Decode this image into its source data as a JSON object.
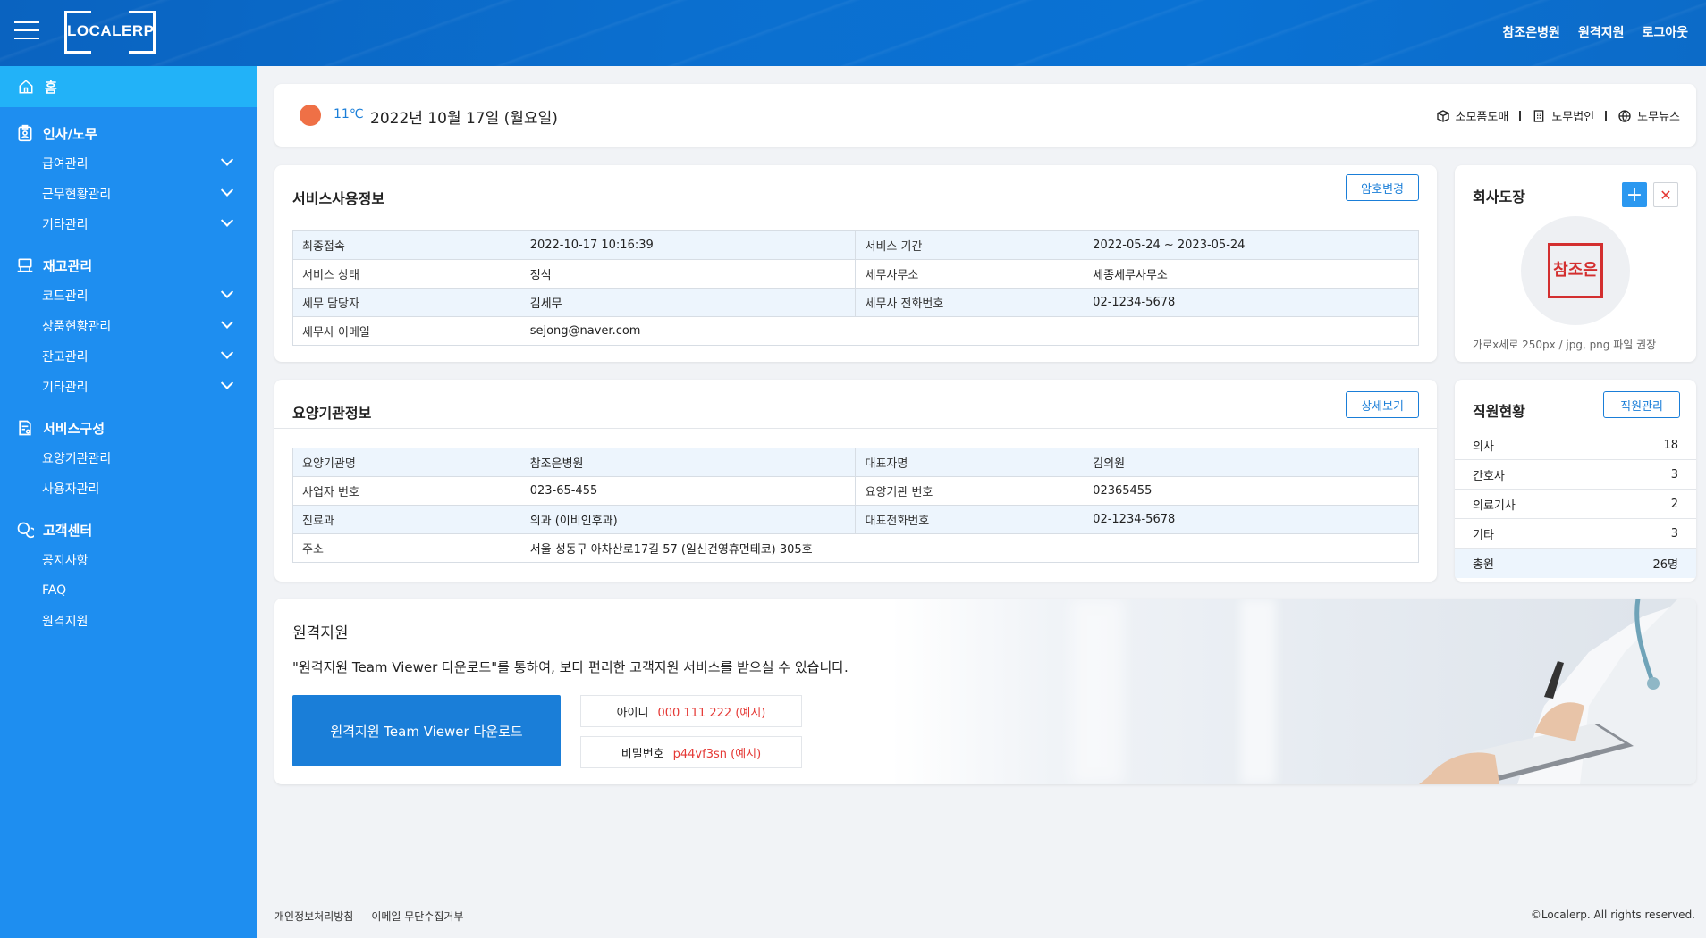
{
  "header": {
    "logo": "LOCALERP",
    "nav": [
      "참조은병원",
      "원격지원",
      "로그아웃"
    ]
  },
  "sidebar": {
    "home": "홈",
    "groups": [
      {
        "title": "인사/노무",
        "items": [
          "급여관리",
          "근무현황관리",
          "기타관리"
        ]
      },
      {
        "title": "재고관리",
        "items": [
          "코드관리",
          "상품현황관리",
          "잔고관리",
          "기타관리"
        ]
      },
      {
        "title": "서비스구성",
        "items": [
          "요양기관관리",
          "사용자관리"
        ]
      },
      {
        "title": "고객센터",
        "items": [
          "공지사항",
          "FAQ",
          "원격지원"
        ]
      }
    ]
  },
  "weather": {
    "temp": "11℃",
    "date": "2022년 10월 17일 (월요일)",
    "links": [
      "소모품도매",
      "노무법인",
      "노무뉴스"
    ]
  },
  "service_info": {
    "title": "서비스사용정보",
    "button": "암호변경",
    "rows": [
      [
        "최종접속",
        "2022-10-17 10:16:39",
        "서비스 기간",
        "2022-05-24 ~ 2023-05-24"
      ],
      [
        "서비스 상태",
        "정식",
        "세무사무소",
        "세종세무사무소"
      ],
      [
        "세무 담당자",
        "김세무",
        "세무사 전화번호",
        "02-1234-5678"
      ],
      [
        "세무사 이메일",
        "sejong@naver.com"
      ]
    ]
  },
  "facility_info": {
    "title": "요양기관정보",
    "button": "상세보기",
    "rows": [
      [
        "요양기관명",
        "참조은병원",
        "대표자명",
        "김의원"
      ],
      [
        "사업자 번호",
        "023-65-455",
        "요양기관 번호",
        "02365455"
      ],
      [
        "진료과",
        "의과 (이비인후과)",
        "대표전화번호",
        "02-1234-5678"
      ],
      [
        "주소",
        "서울 성동구 아차산로17길 57 (일신건영휴먼테코) 305호"
      ]
    ]
  },
  "stamp": {
    "title": "회사도장",
    "stamp_text": "참조은",
    "hint": "가로x세로 250px / jpg, png 파일 권장"
  },
  "staff": {
    "title": "직원현황",
    "button": "직원관리",
    "rows": [
      {
        "label": "의사",
        "value": "18"
      },
      {
        "label": "간호사",
        "value": "3"
      },
      {
        "label": "의료기사",
        "value": "2"
      },
      {
        "label": "기타",
        "value": "3"
      }
    ],
    "total_label": "총원",
    "total_value": "26명"
  },
  "remote": {
    "title": "원격지원",
    "desc": "\"원격지원 Team Viewer 다운로드\"를 통하여, 보다 편리한 고객지원 서비스를 받으실 수 있습니다.",
    "button": "원격지원 Team Viewer 다운로드",
    "id_label": "아이디",
    "id_value": "000 111 222 (예시)",
    "pw_label": "비밀번호",
    "pw_value": "p44vf3sn (예시)"
  },
  "footer": {
    "links": [
      "개인정보처리방침",
      "이메일 무단수집거부"
    ],
    "copyright": "©Localerp. All rights reserved."
  },
  "colors": {
    "header": "#0b6fcf",
    "sidebar": "#1e8ef0",
    "sidebar_active": "#22b2f8",
    "accent": "#1a7ed8",
    "danger": "#e53935",
    "weather_icon": "#ef7046"
  }
}
